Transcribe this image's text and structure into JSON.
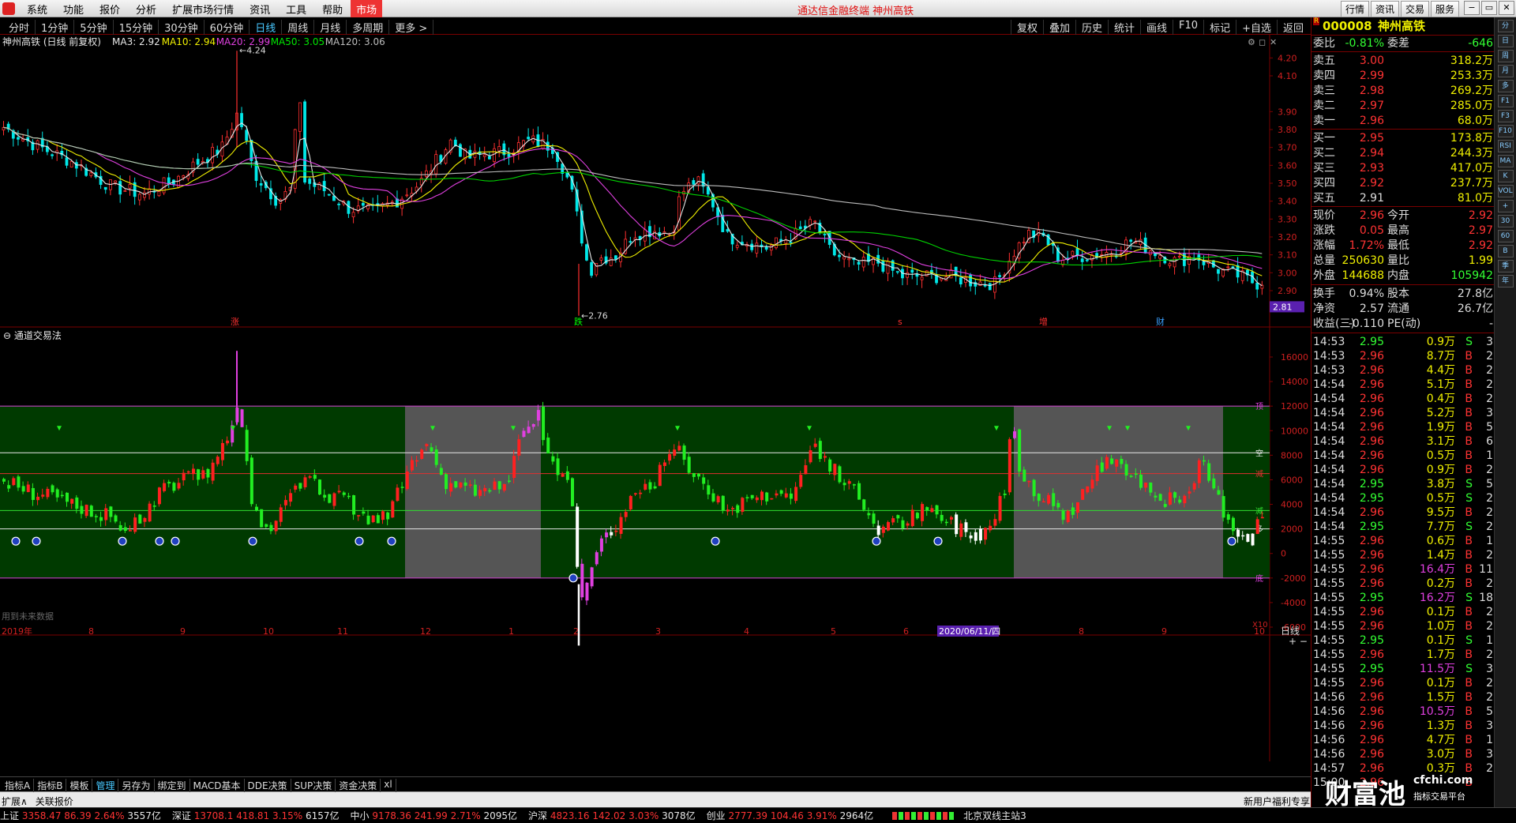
{
  "menubar": {
    "items": [
      "系统",
      "功能",
      "报价",
      "分析",
      "扩展市场行情",
      "资讯",
      "工具",
      "帮助",
      "市场"
    ],
    "title": "通达信金融终端  神州高铁",
    "buttons": [
      "行情",
      "资讯",
      "交易",
      "服务"
    ],
    "win": [
      "−",
      "▭",
      "✕"
    ]
  },
  "periodbar": {
    "periods": [
      "分时",
      "1分钟",
      "5分钟",
      "15分钟",
      "30分钟",
      "60分钟",
      "日线",
      "周线",
      "月线",
      "多周期",
      "更多 >"
    ],
    "active": 6,
    "tools": [
      "复权",
      "叠加",
      "历史",
      "统计",
      "画线",
      "F10",
      "标记",
      "+自选",
      "返回"
    ]
  },
  "main_chart": {
    "title": "神州高铁 (日线 前复权)",
    "ma": [
      {
        "name": "MA3: 2.92",
        "color": "#e8e8e8"
      },
      {
        "name": "MA10: 2.94",
        "color": "#f0f000"
      },
      {
        "name": "MA20: 2.99",
        "color": "#e040e0"
      },
      {
        "name": "MA50: 3.05",
        "color": "#00e800"
      },
      {
        "name": "MA120: 3.06",
        "color": "#bdbdbd"
      }
    ],
    "high_label": "4.24",
    "low_label": "2.76",
    "yticks": [
      "4.20",
      "4.10",
      "3.90",
      "3.80",
      "3.70",
      "3.60",
      "3.50",
      "3.40",
      "3.30",
      "3.20",
      "3.10",
      "3.00",
      "2.90"
    ],
    "last_price": "2.81",
    "markers": [
      "涨",
      "跌",
      "s",
      "增",
      "财"
    ],
    "settings_icons": [
      "⚙",
      "◻",
      "✕"
    ]
  },
  "indicator": {
    "title": "通道交易法",
    "yticks": [
      "16000",
      "14000",
      "12000",
      "10000",
      "8000",
      "6000",
      "4000",
      "2000",
      "0",
      "-2000",
      "-4000",
      "-6000"
    ],
    "side_labels": [
      "顶",
      "空",
      "减",
      "减",
      "多",
      "底"
    ],
    "footer": "用到未来数据",
    "unit": "X10"
  },
  "xaxis": {
    "labels": [
      "2019年",
      "8",
      "9",
      "10",
      "11",
      "12",
      "1",
      "2",
      "3",
      "4",
      "5",
      "6",
      "2020/06/11/四",
      "8",
      "9",
      "10"
    ],
    "right_label": "日线"
  },
  "bottom_tabs": {
    "tabs": [
      "指标A",
      "指标B",
      "模板",
      "管理",
      "另存为",
      "绑定到",
      "MACD基本",
      "DDE决策",
      "SUP决策",
      "资金决策",
      "xl"
    ],
    "active": 3,
    "line2": [
      "扩展∧",
      "关联报价"
    ],
    "right": "新用户福利专享"
  },
  "index_bar": [
    {
      "name": "上证",
      "price": "3358.47",
      "chg": "86.39",
      "pct": "2.64%",
      "amt": "3557亿"
    },
    {
      "name": "深证",
      "price": "13708.1",
      "chg": "418.81",
      "pct": "3.15%",
      "amt": "6157亿"
    },
    {
      "name": "中小",
      "price": "9178.36",
      "chg": "241.99",
      "pct": "2.71%",
      "amt": "2095亿"
    },
    {
      "name": "沪深",
      "price": "4823.16",
      "chg": "142.02",
      "pct": "3.03%",
      "amt": "3078亿"
    },
    {
      "name": "创业",
      "price": "2777.39",
      "chg": "104.46",
      "pct": "3.91%",
      "amt": "2964亿"
    }
  ],
  "server": "北京双线主站3",
  "sidebar": {
    "code": "000008",
    "name": "神州高铁",
    "weibi": {
      "label": "委比",
      "value": "-0.81%",
      "label2": "委差",
      "value2": "-646"
    },
    "sell": [
      {
        "l": "卖五",
        "p": "3.00",
        "v": "318.2万"
      },
      {
        "l": "卖四",
        "p": "2.99",
        "v": "253.3万"
      },
      {
        "l": "卖三",
        "p": "2.98",
        "v": "269.2万"
      },
      {
        "l": "卖二",
        "p": "2.97",
        "v": "285.0万"
      },
      {
        "l": "卖一",
        "p": "2.96",
        "v": "68.0万"
      }
    ],
    "buy": [
      {
        "l": "买一",
        "p": "2.95",
        "v": "173.8万"
      },
      {
        "l": "买二",
        "p": "2.94",
        "v": "244.3万"
      },
      {
        "l": "买三",
        "p": "2.93",
        "v": "417.0万"
      },
      {
        "l": "买四",
        "p": "2.92",
        "v": "237.7万"
      },
      {
        "l": "买五",
        "p": "2.91",
        "v": "81.0万"
      }
    ],
    "stats": [
      {
        "a": "现价",
        "av": "2.96",
        "b": "今开",
        "bv": "2.92"
      },
      {
        "a": "涨跌",
        "av": "0.05",
        "b": "最高",
        "bv": "2.97"
      },
      {
        "a": "涨幅",
        "av": "1.72%",
        "b": "最低",
        "bv": "2.92"
      },
      {
        "a": "总量",
        "av": "250630",
        "b": "量比",
        "bv": "1.99"
      },
      {
        "a": "外盘",
        "av": "144688",
        "b": "内盘",
        "bv": "105942"
      }
    ],
    "stats2": [
      {
        "a": "换手",
        "av": "0.94%",
        "b": "股本",
        "bv": "27.8亿"
      },
      {
        "a": "净资",
        "av": "2.57",
        "b": "流通",
        "bv": "26.7亿"
      },
      {
        "a": "收益(三)",
        "av": "-0.110",
        "b": "PE(动)",
        "bv": "-"
      }
    ],
    "ticks": [
      [
        "14:53",
        "2.95",
        "0.9万",
        "S",
        "3"
      ],
      [
        "14:53",
        "2.96",
        "8.7万",
        "B",
        "2"
      ],
      [
        "14:53",
        "2.96",
        "4.4万",
        "B",
        "2"
      ],
      [
        "14:54",
        "2.96",
        "5.1万",
        "B",
        "2"
      ],
      [
        "14:54",
        "2.96",
        "0.4万",
        "B",
        "2"
      ],
      [
        "14:54",
        "2.96",
        "5.2万",
        "B",
        "3"
      ],
      [
        "14:54",
        "2.96",
        "1.9万",
        "B",
        "5"
      ],
      [
        "14:54",
        "2.96",
        "3.1万",
        "B",
        "6"
      ],
      [
        "14:54",
        "2.96",
        "0.5万",
        "B",
        "1"
      ],
      [
        "14:54",
        "2.96",
        "0.9万",
        "B",
        "2"
      ],
      [
        "14:54",
        "2.95",
        "3.8万",
        "S",
        "5"
      ],
      [
        "14:54",
        "2.95",
        "0.5万",
        "S",
        "2"
      ],
      [
        "14:54",
        "2.96",
        "9.5万",
        "B",
        "2"
      ],
      [
        "14:54",
        "2.95",
        "7.7万",
        "S",
        "2"
      ],
      [
        "14:55",
        "2.96",
        "0.6万",
        "B",
        "1"
      ],
      [
        "14:55",
        "2.96",
        "1.4万",
        "B",
        "2"
      ],
      [
        "14:55",
        "2.96",
        "16.4万",
        "B",
        "11"
      ],
      [
        "14:55",
        "2.96",
        "0.2万",
        "B",
        "2"
      ],
      [
        "14:55",
        "2.95",
        "16.2万",
        "S",
        "18"
      ],
      [
        "14:55",
        "2.96",
        "0.1万",
        "B",
        "2"
      ],
      [
        "14:55",
        "2.96",
        "1.0万",
        "B",
        "2"
      ],
      [
        "14:55",
        "2.95",
        "0.1万",
        "S",
        "1"
      ],
      [
        "14:55",
        "2.96",
        "1.7万",
        "B",
        "2"
      ],
      [
        "14:55",
        "2.95",
        "11.5万",
        "S",
        "3"
      ],
      [
        "14:55",
        "2.96",
        "0.1万",
        "B",
        "2"
      ],
      [
        "14:56",
        "2.96",
        "1.5万",
        "B",
        "2"
      ],
      [
        "14:56",
        "2.96",
        "10.5万",
        "B",
        "5"
      ],
      [
        "14:56",
        "2.96",
        "1.3万",
        "B",
        "3"
      ],
      [
        "14:56",
        "2.96",
        "4.7万",
        "B",
        "1"
      ],
      [
        "14:56",
        "2.96",
        "3.0万",
        "B",
        "3"
      ],
      [
        "14:57",
        "2.96",
        "0.3万",
        "B",
        "2"
      ],
      [
        "15:00",
        "2.96",
        "",
        "B",
        ""
      ]
    ]
  },
  "right_icons": [
    "分",
    "日",
    "周",
    "月",
    "多",
    "F1",
    "F3",
    "F10",
    "RSI",
    "MA",
    "K",
    "VOL",
    "+",
    "30",
    "60",
    "B",
    "季",
    "年"
  ],
  "watermark": {
    "cn": "财富池",
    "en": "cfchi.com",
    "sub": "指标交易平台"
  }
}
